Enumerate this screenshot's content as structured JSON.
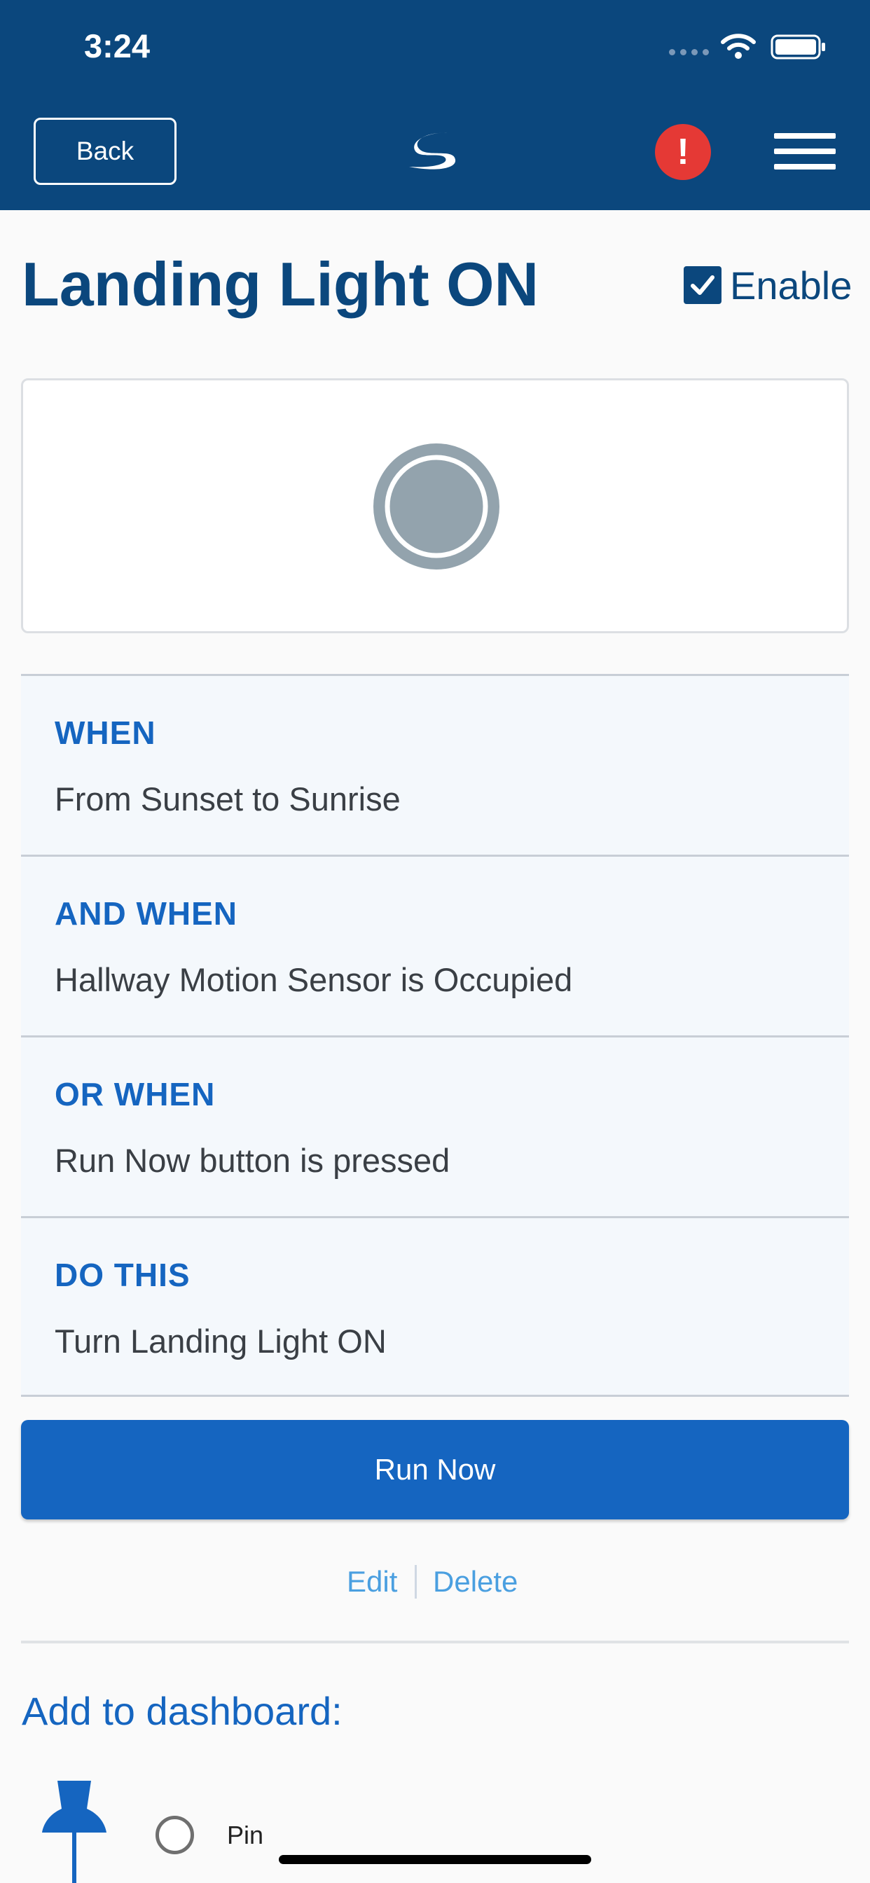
{
  "status_bar": {
    "time": "3:24"
  },
  "header": {
    "back_label": "Back",
    "alert_symbol": "!",
    "brand_color": "#0b477d"
  },
  "scene": {
    "title": "Landing Light ON",
    "enable_label": "Enable",
    "enabled": true
  },
  "rules": [
    {
      "label": "WHEN",
      "text": "From Sunset to Sunrise"
    },
    {
      "label": "AND WHEN",
      "text": "Hallway Motion Sensor is Occupied"
    },
    {
      "label": "OR WHEN",
      "text": "Run Now button is pressed"
    },
    {
      "label": "DO THIS",
      "text": "Turn Landing Light ON"
    }
  ],
  "actions": {
    "run_now": "Run Now",
    "edit": "Edit",
    "delete": "Delete"
  },
  "dashboard": {
    "title": "Add to dashboard:",
    "pin_label": "Pin",
    "pinned": false
  },
  "colors": {
    "accent": "#1565c0",
    "alert": "#e53935",
    "link": "#4a9fe0"
  },
  "icons": [
    "wifi-icon",
    "battery-icon",
    "brand-logo-icon",
    "alert-icon",
    "menu-icon",
    "checkbox-checked-icon",
    "status-indicator-icon",
    "pin-icon",
    "radio-unchecked-icon"
  ]
}
